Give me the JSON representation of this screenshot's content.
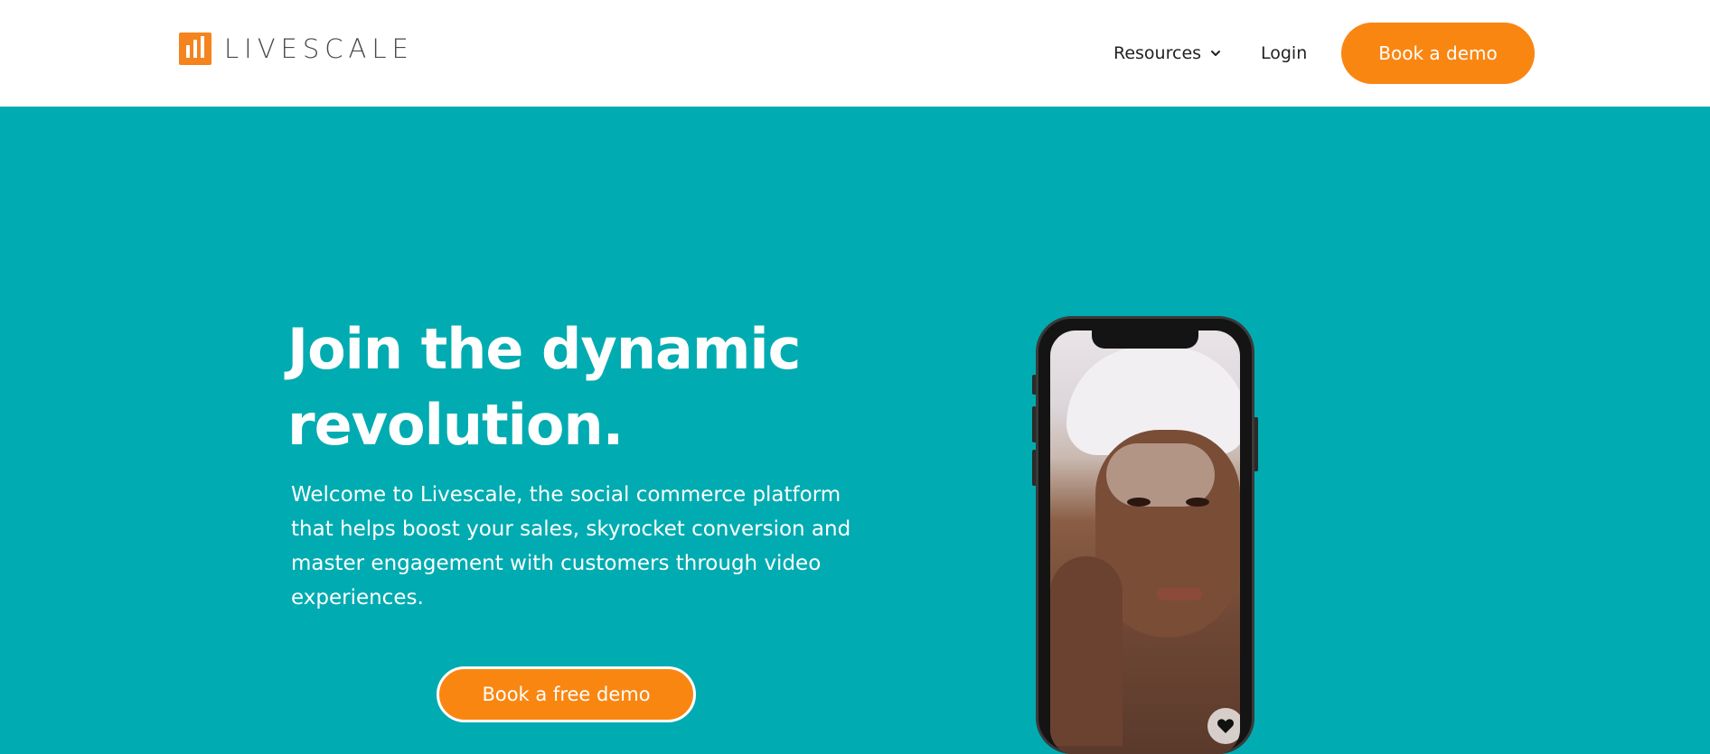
{
  "header": {
    "logo_text": "LIVESCALE",
    "nav": {
      "resources_label": "Resources",
      "login_label": "Login",
      "cta_label": "Book a demo"
    }
  },
  "hero": {
    "title_line1": "Join the dynamic",
    "title_line2": "revolution.",
    "subtitle_line1": "Welcome to Livescale, the social commerce platform",
    "subtitle_line2": "that helps boost your sales, skyrocket conversion and",
    "subtitle_line3": "master engagement with customers through video",
    "subtitle_line4": "experiences.",
    "cta_label": "Book a free demo"
  },
  "colors": {
    "brand_orange": "#fa8612",
    "hero_teal": "#00acb1",
    "white": "#ffffff"
  },
  "icons": {
    "logo": "livescale-logo-icon",
    "resources_chevron": "chevron-down-icon",
    "heart": "heart-icon"
  }
}
